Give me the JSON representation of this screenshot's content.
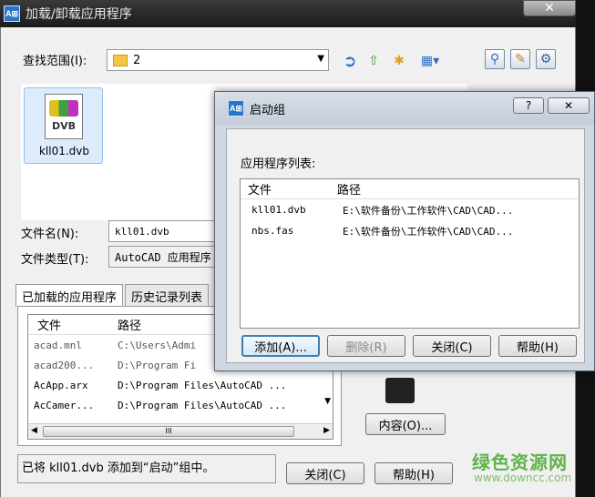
{
  "main": {
    "title": "加载/卸载应用程序",
    "close_glyph": "✕",
    "lookin_label": "查找范围(I):",
    "lookin_value": "2",
    "file_item_name": "kll01.dvb",
    "file_icon_text": "DVB",
    "filename_label": "文件名(N):",
    "filename_value": "kll01.dvb",
    "filetype_label": "文件类型(T):",
    "filetype_value": "AutoCAD 应用程序",
    "tabs": [
      {
        "label": "已加载的应用程序"
      },
      {
        "label": "历史记录列表"
      }
    ],
    "columns": {
      "file": "文件",
      "path": "路径"
    },
    "rows": [
      {
        "file": "acad.mnl",
        "path": "C:\\Users\\Admi"
      },
      {
        "file": "acad200...",
        "path": "D:\\Program Fi"
      },
      {
        "file": "AcApp.arx",
        "path": "D:\\Program Files\\AutoCAD ..."
      },
      {
        "file": "AcCamer...",
        "path": "D:\\Program Files\\AutoCAD ..."
      }
    ],
    "scroll_thumb": "III",
    "content_button": "内容(O)...",
    "status": "已将 kll01.dvb 添加到“启动”组中。",
    "close_button": "关闭(C)",
    "help_button": "帮助(H)"
  },
  "startup": {
    "title": "启动组",
    "help_glyph": "?",
    "close_glyph": "✕",
    "list_label": "应用程序列表:",
    "columns": {
      "file": "文件",
      "path": "路径"
    },
    "rows": [
      {
        "file": "kll01.dvb",
        "path": "E:\\软件备份\\工作软件\\CAD\\CAD..."
      },
      {
        "file": "nbs.fas",
        "path": "E:\\软件备份\\工作软件\\CAD\\CAD..."
      }
    ],
    "add_button": "添加(A)...",
    "remove_button": "删除(R)",
    "close_button": "关闭(C)",
    "help_button": "帮助(H)"
  },
  "watermark": {
    "text": "绿色资源网",
    "url": "www.downcc.com"
  }
}
